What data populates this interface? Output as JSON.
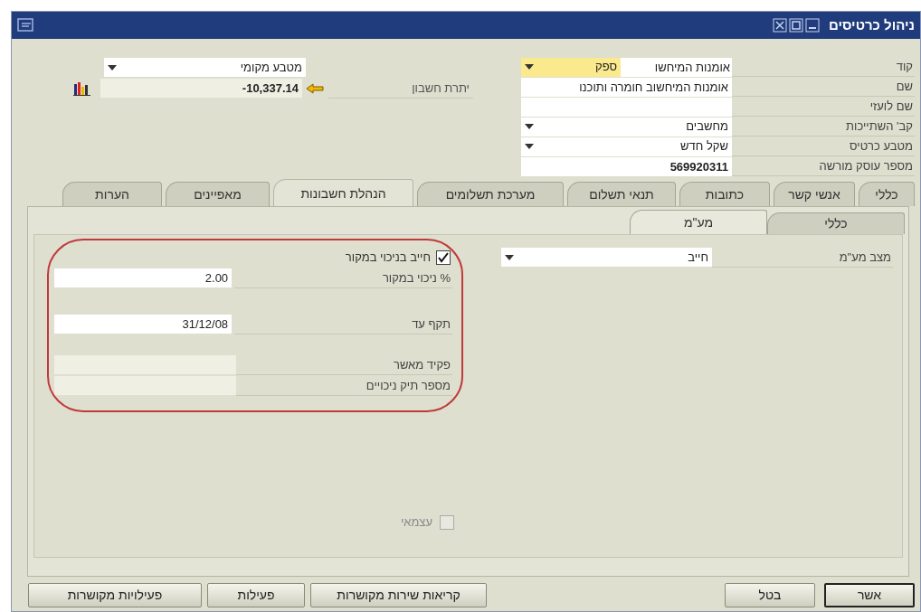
{
  "window": {
    "title": "ניהול כרטיסים"
  },
  "header": {
    "fields": [
      {
        "label": "קוד",
        "kind": "code",
        "value": "אומנות המיחשו",
        "type_value": "ספק"
      },
      {
        "label": "שם",
        "kind": "text",
        "value": "אומנות המיחשוב חומרה ותוכנו"
      },
      {
        "label": "שם לועזי",
        "kind": "text"
      },
      {
        "label": "קב' השתייכות",
        "kind": "dropdown",
        "value": "מחשבים"
      },
      {
        "label": "מטבע כרטיס",
        "kind": "dropdown",
        "value": "שקל חדש"
      },
      {
        "label": "מספר עוסק מורשה",
        "kind": "text",
        "value": "569920311"
      }
    ],
    "balance": {
      "currency": "מטבע מקומי",
      "label": "יתרת חשבון",
      "value": "-10,337.14"
    }
  },
  "tabs": [
    {
      "label": "כללי",
      "selected": false
    },
    {
      "label": "אנשי קשר",
      "selected": false
    },
    {
      "label": "כתובות",
      "selected": false
    },
    {
      "label": "תנאי תשלום",
      "selected": false
    },
    {
      "label": "מערכת תשלומים",
      "selected": false
    },
    {
      "label": "הנהלת חשבונות",
      "selected": true
    },
    {
      "label": "מאפיינים",
      "selected": false
    },
    {
      "label": "הערות",
      "selected": false
    }
  ],
  "subtabs": [
    {
      "label": "כללי",
      "selected": false
    },
    {
      "label": "מע\"מ",
      "selected": true
    }
  ],
  "vat_status": {
    "label": "מצב מע\"מ",
    "value": "חייב"
  },
  "withholding": {
    "checkbox": {
      "label": "חייב בניכוי במקור",
      "checked": true
    },
    "fields": [
      {
        "label": "% ניכוי במקור",
        "value": "2.00"
      },
      {
        "label": "תקף עד",
        "value": "31/12/08"
      },
      {
        "label": "פקיד מאשר"
      },
      {
        "label": "מספר תיק ניכויים"
      }
    ]
  },
  "self_employed": {
    "label": "עצמאי",
    "checked": false,
    "disabled": true
  },
  "buttons_right": [
    {
      "label": "אשר",
      "default": true
    },
    {
      "label": "בטל",
      "default": false
    }
  ],
  "buttons_left": [
    {
      "label": "קריאות שירות מקושרות"
    },
    {
      "label": "פעילות"
    },
    {
      "label": "פעילויות מקושרות"
    }
  ]
}
